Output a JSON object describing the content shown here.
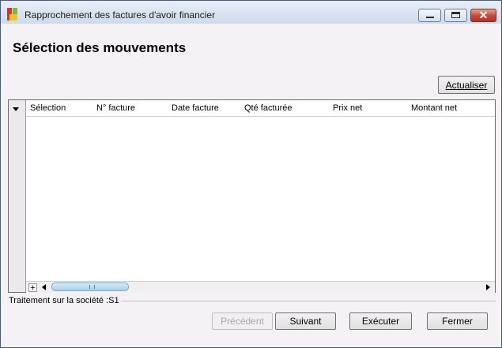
{
  "window": {
    "title": "Rapprochement des factures d'avoir financier"
  },
  "section": {
    "title": "Sélection des mouvements"
  },
  "toolbar": {
    "refresh_label": "Actualiser"
  },
  "grid": {
    "columns": [
      "Sélection",
      "N° facture",
      "Date facture",
      "Qté facturée",
      "Prix net",
      "Montant net"
    ],
    "rows": []
  },
  "status": {
    "text": "Traitement sur la société :S1"
  },
  "buttons": {
    "previous": "Précédent",
    "next": "Suivant",
    "execute": "Exécuter",
    "close": "Fermer"
  }
}
